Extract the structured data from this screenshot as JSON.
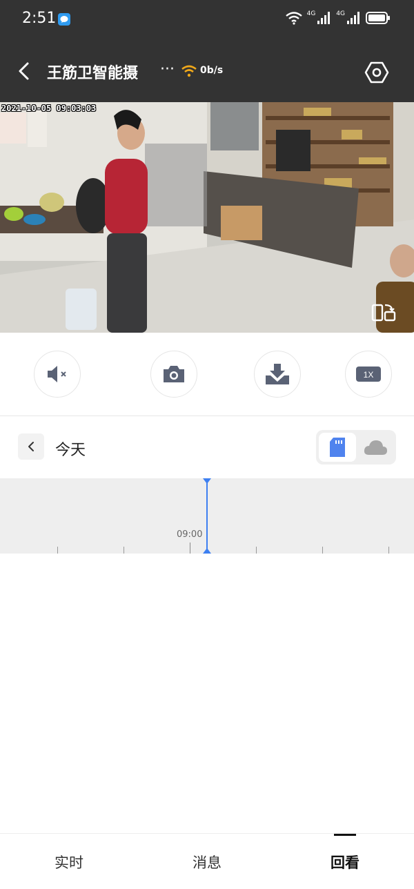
{
  "status_bar": {
    "time": "2:51",
    "signal1": "4G",
    "signal2": "4G"
  },
  "header": {
    "title": "王筋卫智能摄",
    "ellipsis": "···",
    "rate": "0b/s"
  },
  "video": {
    "timestamp": "2021-10-05 09:03:03"
  },
  "date_nav": {
    "label": "今天"
  },
  "timeline": {
    "label": "09:00"
  },
  "bottom_nav": {
    "items": [
      "实时",
      "消息",
      "回看"
    ],
    "active": "回看"
  },
  "colors": {
    "accent": "#3d7ff1",
    "header_bg": "#333333"
  }
}
